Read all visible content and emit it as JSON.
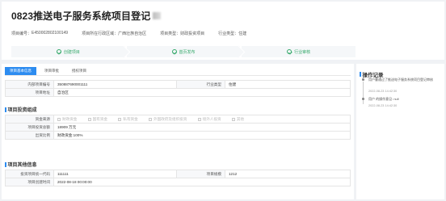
{
  "header": {
    "title": "0823推送电子服务系统项目登记",
    "meta": [
      {
        "label": "项目编号：",
        "value": "E450002802100149"
      },
      {
        "label": "项目所在行政区域：",
        "value": "广西壮族自治区"
      },
      {
        "label": "项目类型：",
        "value": "财政投资项目"
      },
      {
        "label": "行业类型：",
        "value": "住建"
      }
    ],
    "steps": [
      "创建项目",
      "首页发布",
      "行业审核"
    ]
  },
  "tabs": [
    "项目基本信息",
    "项目审批",
    "授权项目"
  ],
  "basic": {
    "rows": [
      {
        "label": "内部项目编号",
        "value": "350887690001111",
        "label2": "行业类型",
        "value2": "住建"
      },
      {
        "label": "项目地址",
        "value": "自治区"
      }
    ]
  },
  "investment": {
    "section_title": "项目投资组成",
    "source_label": "资金来源",
    "sources": [
      "财政资金",
      "国有资金",
      "私有资金",
      "外国政府及组织投资",
      "境外人投资",
      "其他"
    ],
    "total_label": "项目投资总额",
    "total_value": "18909 万元",
    "ratio_label": "出资比例",
    "ratio_value": "财政资金:100%"
  },
  "other": {
    "section_title": "项目其他信息",
    "rows": [
      {
        "label": "投资项目统一代码",
        "value": "111111",
        "label2": "项目规模",
        "value2": "1212"
      },
      {
        "label": "项目创建时间",
        "value": "2022-08-18 00:00:00"
      }
    ]
  },
  "side": {
    "title": "操作记录",
    "records": [
      {
        "text": "用户曹通过了推送电子服务系统项目登记审核",
        "time": "2022-08-23 14:42:30"
      },
      {
        "text": "用户 的操作意见: null",
        "time": "2022-08-23 14:42:30"
      }
    ]
  },
  "colors": {
    "accent": "#2d8cf0",
    "success": "#35a96a"
  }
}
